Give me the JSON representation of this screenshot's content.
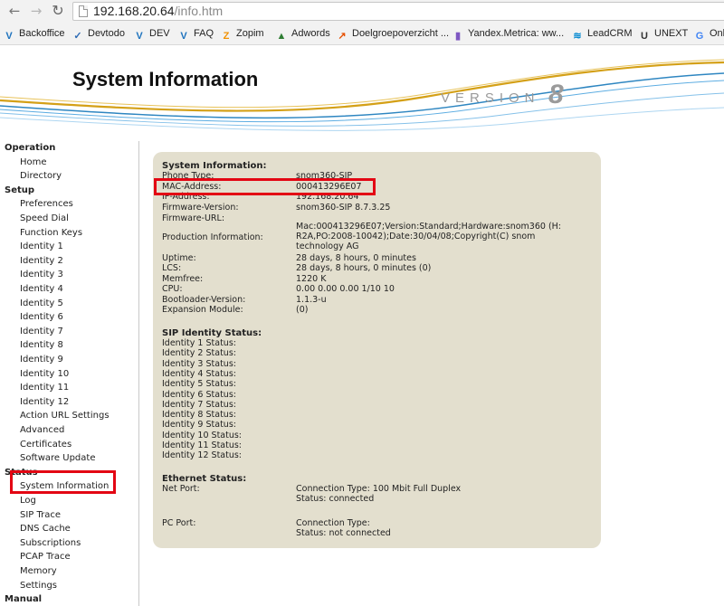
{
  "browser": {
    "url_host": "192.168.20.64",
    "url_path": "/info.htm",
    "bookmarks": [
      {
        "label": "Backoffice",
        "icon": "V",
        "color": "#1e73be"
      },
      {
        "label": "Devtodo",
        "icon": "✓",
        "color": "#2d6ab4"
      },
      {
        "label": "DEV",
        "icon": "V",
        "color": "#1e73be"
      },
      {
        "label": "FAQ",
        "icon": "V",
        "color": "#1e73be"
      },
      {
        "label": "Zopim",
        "icon": "Z",
        "color": "#f29100"
      },
      {
        "label": "Adwords",
        "icon": "▲",
        "color": "#2e7d32"
      },
      {
        "label": "Doelgroepoverzicht ...",
        "icon": "↗",
        "color": "#e65100"
      },
      {
        "label": "Yandex.Metrica: ww...",
        "icon": "▮",
        "color": "#7e57c2"
      },
      {
        "label": "LeadCRM",
        "icon": "≋",
        "color": "#0288d1"
      },
      {
        "label": "UNEXT",
        "icon": "U",
        "color": "#333333"
      },
      {
        "label": "Onl",
        "icon": "G",
        "color": "#4285f4"
      }
    ]
  },
  "header": {
    "title": "System Information",
    "version_word": "VERSION",
    "version_num": "8"
  },
  "sidebar": {
    "rows": [
      {
        "type": "head",
        "label": "Operation"
      },
      {
        "type": "item",
        "label": "Home"
      },
      {
        "type": "item",
        "label": "Directory"
      },
      {
        "type": "head",
        "label": "Setup"
      },
      {
        "type": "item",
        "label": "Preferences"
      },
      {
        "type": "item",
        "label": "Speed Dial"
      },
      {
        "type": "item",
        "label": "Function Keys"
      },
      {
        "type": "item",
        "label": "Identity 1"
      },
      {
        "type": "item",
        "label": "Identity 2"
      },
      {
        "type": "item",
        "label": "Identity 3"
      },
      {
        "type": "item",
        "label": "Identity 4"
      },
      {
        "type": "item",
        "label": "Identity 5"
      },
      {
        "type": "item",
        "label": "Identity 6"
      },
      {
        "type": "item",
        "label": "Identity 7"
      },
      {
        "type": "item",
        "label": "Identity 8"
      },
      {
        "type": "item",
        "label": "Identity 9"
      },
      {
        "type": "item",
        "label": "Identity 10"
      },
      {
        "type": "item",
        "label": "Identity 11"
      },
      {
        "type": "item",
        "label": "Identity 12"
      },
      {
        "type": "item",
        "label": "Action URL Settings"
      },
      {
        "type": "item",
        "label": "Advanced"
      },
      {
        "type": "item",
        "label": "Certificates"
      },
      {
        "type": "item",
        "label": "Software Update"
      },
      {
        "type": "head",
        "label": "Status"
      },
      {
        "type": "item",
        "label": "System Information"
      },
      {
        "type": "item",
        "label": "Log"
      },
      {
        "type": "item",
        "label": "SIP Trace"
      },
      {
        "type": "item",
        "label": "DNS Cache"
      },
      {
        "type": "item",
        "label": "Subscriptions"
      },
      {
        "type": "item",
        "label": "PCAP Trace"
      },
      {
        "type": "item",
        "label": "Memory"
      },
      {
        "type": "item",
        "label": "Settings"
      },
      {
        "type": "head",
        "label": "Manual"
      }
    ]
  },
  "system_info": {
    "heading": "System Information:",
    "fields": [
      {
        "label": "Phone Type:",
        "value": "snom360-SIP"
      },
      {
        "label": "MAC-Address:",
        "value": "000413296E07"
      },
      {
        "label": "IP-Address:",
        "value": "192.168.20.64"
      },
      {
        "label": "Firmware-Version:",
        "value": "snom360-SIP 8.7.3.25"
      },
      {
        "label": "Firmware-URL:",
        "value": ""
      },
      {
        "label": "Production Information:",
        "value": "Mac:000413296E07;Version:Standard;Hardware:snom360 (H: R2A,PO:2008-10042);Date:30/04/08;Copyright(C) snom technology AG"
      },
      {
        "label": "Uptime:",
        "value": "28 days, 8 hours, 0 minutes"
      },
      {
        "label": "LCS:",
        "value": "28 days, 8 hours, 0 minutes (0)"
      },
      {
        "label": "Memfree:",
        "value": "1220 K"
      },
      {
        "label": "CPU:",
        "value": "0.00 0.00 0.00 1/10 10"
      },
      {
        "label": "Bootloader-Version:",
        "value": "1.1.3-u"
      },
      {
        "label": "Expansion Module:",
        "value": "(0)"
      }
    ]
  },
  "sip_identity": {
    "heading": "SIP Identity Status:",
    "items": [
      "Identity 1 Status:",
      "Identity 2 Status:",
      "Identity 3 Status:",
      "Identity 4 Status:",
      "Identity 5 Status:",
      "Identity 6 Status:",
      "Identity 7 Status:",
      "Identity 8 Status:",
      "Identity 9 Status:",
      "Identity 10 Status:",
      "Identity 11 Status:",
      "Identity 12 Status:"
    ]
  },
  "ethernet": {
    "heading": "Ethernet Status:",
    "net_port": {
      "label": "Net Port:",
      "line1": "Connection Type: 100 Mbit Full Duplex",
      "line2": "Status: connected"
    },
    "pc_port": {
      "label": "PC Port:",
      "line1": "Connection Type:",
      "line2": "Status: not connected"
    }
  },
  "colors": {
    "panel_bg": "#e3dfce",
    "highlight": "#e30613",
    "wave_blue": "#2e86c1",
    "wave_gold": "#d4a017"
  }
}
